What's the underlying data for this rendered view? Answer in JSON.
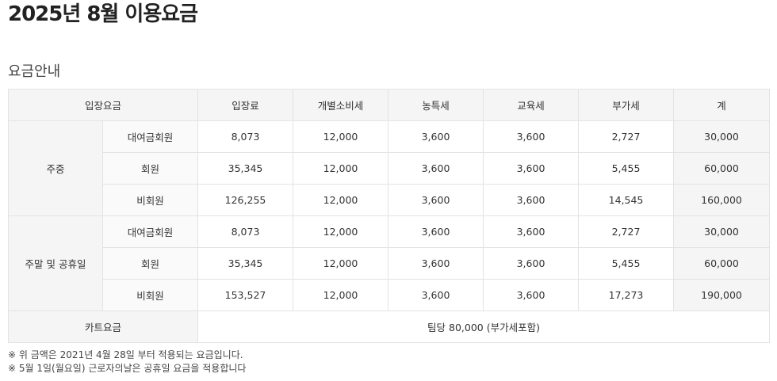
{
  "page": {
    "title": "2025년 8월 이용요금",
    "section_title": "요금안내"
  },
  "table": {
    "headers": [
      "입장요금",
      "입장료",
      "개별소비세",
      "농특세",
      "교육세",
      "부가세",
      "계"
    ],
    "groups": [
      {
        "label": "주중",
        "rows": [
          {
            "category": "대여금회원",
            "values": [
              "8,073",
              "12,000",
              "3,600",
              "3,600",
              "2,727"
            ],
            "total": "30,000"
          },
          {
            "category": "회원",
            "values": [
              "35,345",
              "12,000",
              "3,600",
              "3,600",
              "5,455"
            ],
            "total": "60,000"
          },
          {
            "category": "비회원",
            "values": [
              "126,255",
              "12,000",
              "3,600",
              "3,600",
              "14,545"
            ],
            "total": "160,000"
          }
        ]
      },
      {
        "label": "주말 및 공휴일",
        "rows": [
          {
            "category": "대여금회원",
            "values": [
              "8,073",
              "12,000",
              "3,600",
              "3,600",
              "2,727"
            ],
            "total": "30,000"
          },
          {
            "category": "회원",
            "values": [
              "35,345",
              "12,000",
              "3,600",
              "3,600",
              "5,455"
            ],
            "total": "60,000"
          },
          {
            "category": "비회원",
            "values": [
              "153,527",
              "12,000",
              "3,600",
              "3,600",
              "17,273"
            ],
            "total": "190,000"
          }
        ]
      }
    ],
    "cart": {
      "label": "카트요금",
      "value": "팀당 80,000 (부가세포함)"
    }
  },
  "notes": [
    "※ 위 금액은 2021년 4월 28일 부터 적용되는 요금입니다.",
    "※ 5월 1일(월요일) 근로자의날은 공휴일 요금을 적용합니다"
  ]
}
